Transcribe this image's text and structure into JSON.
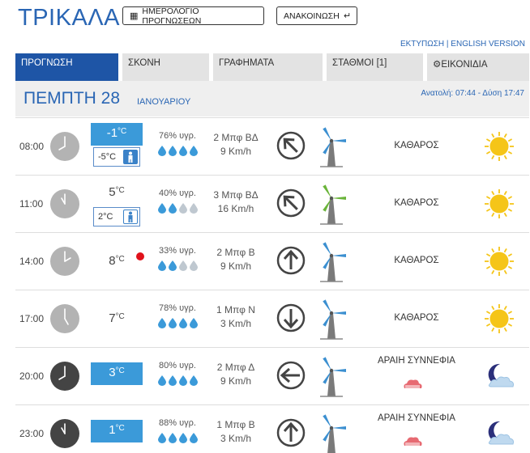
{
  "header": {
    "city": "ΤΡΙΚΑΛΑ",
    "calendar_button": "ΗΜΕΡΟΛΟΓΙΟ ΠΡΟΓΝΩΣΕΩΝ",
    "announcement_button": "ΑΝΑΚΟΙΝΩΣΗ",
    "links": "ΕΚΤΥΠΩΣΗ | ENGLISH VERSION"
  },
  "tabs": [
    "ΠΡΟΓΝΩΣΗ",
    "ΣΚΟΝΗ",
    "ΓΡΑΦΗΜΑΤΑ",
    "ΣΤΑΘΜΟΙ [1]",
    "ΕΙΚΟΝΙΔΙΑ"
  ],
  "day": {
    "name": "ΠΕΜΠΤΗ 28",
    "month": "ΙΑΝΟΥΑΡΙΟΥ",
    "sun": "Ανατολή: 07:44 - Δύση 17:47"
  },
  "rows": [
    {
      "time": "08:00",
      "temp": "-1",
      "unit": "°C",
      "feels": "-5°C",
      "humidity": "76% υγρ.",
      "humidity_drops": 4,
      "wind_bf": "2 Μπφ ΒΔ",
      "wind_kmh": "9 Km/h",
      "condition": "ΚΑΘΑΡΟΣ",
      "weather_icon": "sun-icon"
    },
    {
      "time": "11:00",
      "temp": "5",
      "unit": "°C",
      "feels": "2°C",
      "humidity": "40% υγρ.",
      "humidity_drops": 2,
      "wind_bf": "3 Μπφ ΒΔ",
      "wind_kmh": "16 Km/h",
      "condition": "ΚΑΘΑΡΟΣ",
      "weather_icon": "sun-icon"
    },
    {
      "time": "14:00",
      "temp": "8",
      "unit": "°C",
      "feels": "",
      "humidity": "33% υγρ.",
      "humidity_drops": 2,
      "wind_bf": "2 Μπφ Β",
      "wind_kmh": "9 Km/h",
      "condition": "ΚΑΘΑΡΟΣ",
      "weather_icon": "sun-icon"
    },
    {
      "time": "17:00",
      "temp": "7",
      "unit": "°C",
      "feels": "",
      "humidity": "78% υγρ.",
      "humidity_drops": 4,
      "wind_bf": "1 Μπφ Ν",
      "wind_kmh": "3 Km/h",
      "condition": "ΚΑΘΑΡΟΣ",
      "weather_icon": "sun-icon"
    },
    {
      "time": "20:00",
      "temp": "3",
      "unit": "°C",
      "feels": "",
      "humidity": "80% υγρ.",
      "humidity_drops": 4,
      "wind_bf": "2 Μπφ Δ",
      "wind_kmh": "9 Km/h",
      "condition": "ΑΡΑΙΗ ΣΥΝΝΕΦΙΑ",
      "weather_icon": "moon-cloud-icon"
    },
    {
      "time": "23:00",
      "temp": "1",
      "unit": "°C",
      "feels": "",
      "humidity": "88% υγρ.",
      "humidity_drops": 4,
      "wind_bf": "1 Μπφ Β",
      "wind_kmh": "3 Km/h",
      "condition": "ΑΡΑΙΗ ΣΥΝΝΕΦΙΑ",
      "weather_icon": "moon-cloud-icon"
    }
  ],
  "colors": {
    "accent": "#2a66b4",
    "tab_active": "#1e55a6",
    "temp_box": "#3b9ad9",
    "sun": "#f5c518",
    "drop": "#3b9ad9"
  }
}
